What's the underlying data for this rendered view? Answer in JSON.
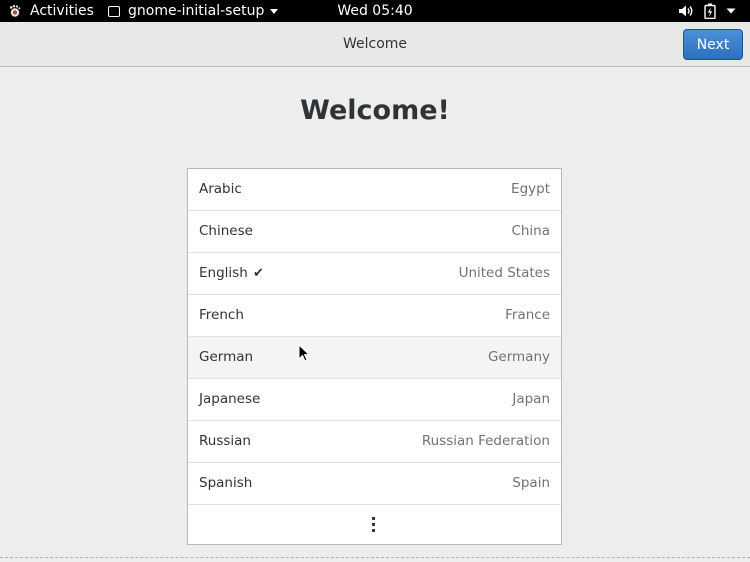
{
  "topbar": {
    "activities_label": "Activities",
    "app_name": "gnome-initial-setup",
    "clock": "Wed 05:40",
    "icons": [
      "gnome-foot-icon",
      "app-window-icon",
      "chevron-down-icon",
      "volume-icon",
      "battery-icon",
      "system-menu-chevron-icon"
    ]
  },
  "header": {
    "title": "Welcome",
    "next_label": "Next",
    "accent_color": "#3477c8"
  },
  "main": {
    "heading": "Welcome!",
    "selected_language": "English",
    "languages": [
      {
        "language": "Arabic",
        "region": "Egypt"
      },
      {
        "language": "Chinese",
        "region": "China"
      },
      {
        "language": "English",
        "region": "United States",
        "check": "✔"
      },
      {
        "language": "French",
        "region": "France"
      },
      {
        "language": "German",
        "region": "Germany"
      },
      {
        "language": "Japanese",
        "region": "Japan"
      },
      {
        "language": "Russian",
        "region": "Russian Federation"
      },
      {
        "language": "Spanish",
        "region": "Spain"
      }
    ],
    "more_icon": "vertical-ellipsis-icon"
  }
}
